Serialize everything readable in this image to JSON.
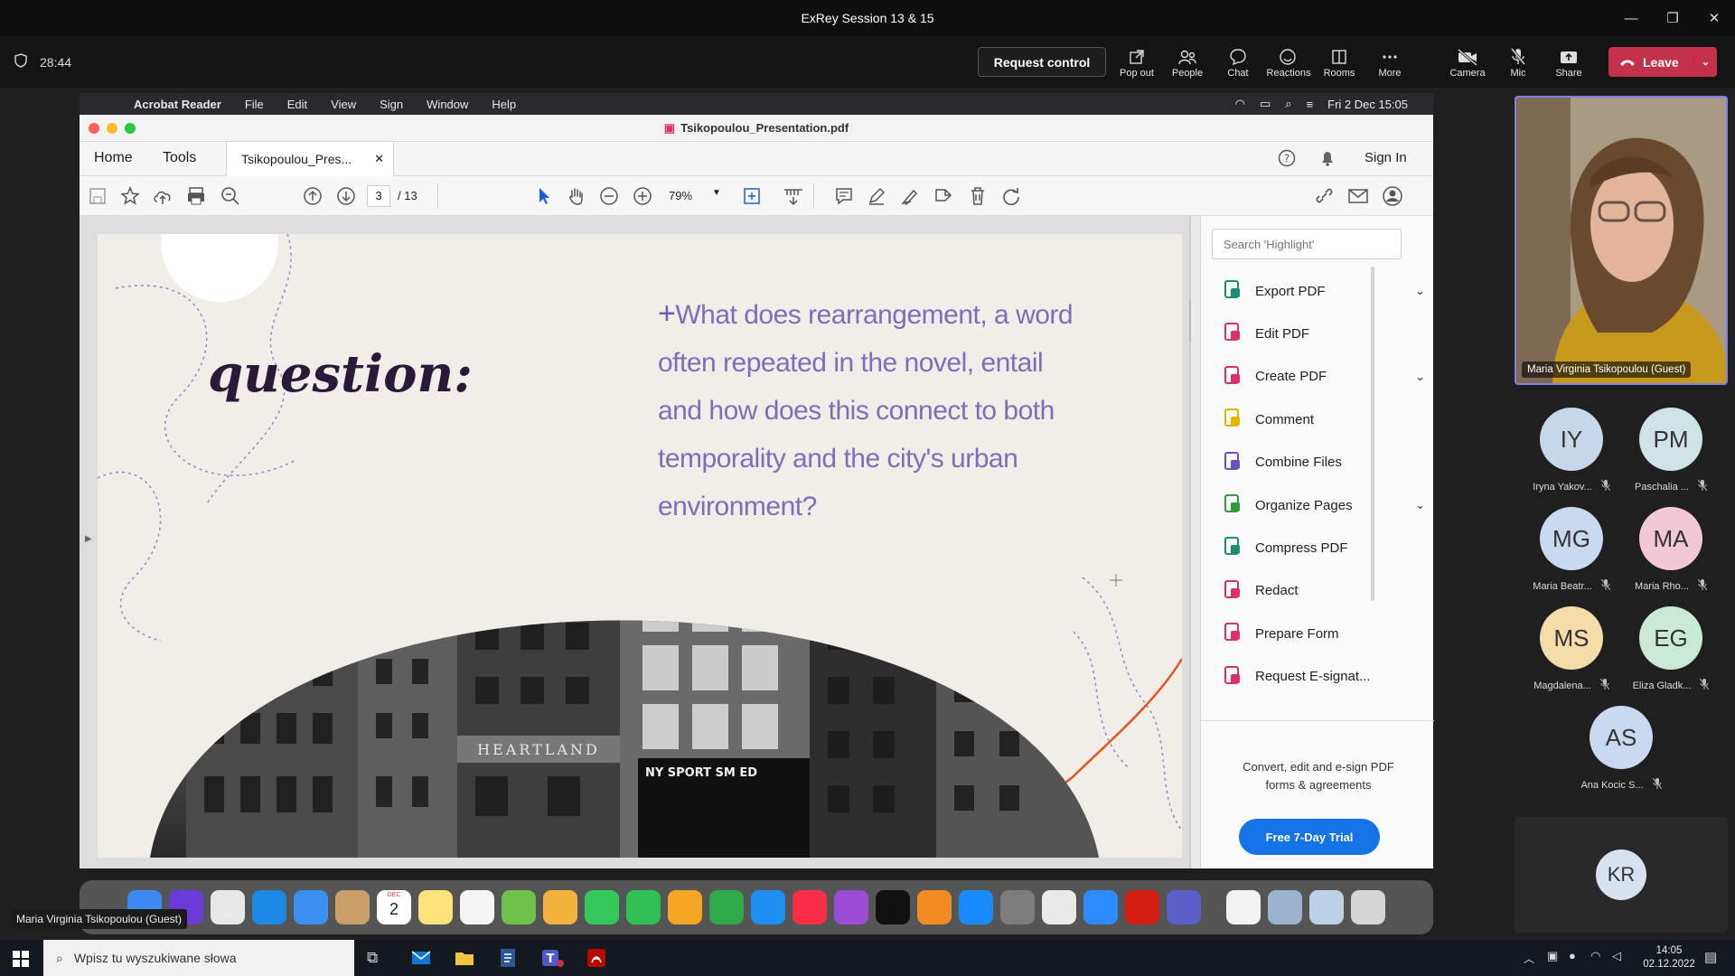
{
  "teams": {
    "title": "ExRey Session 13 & 15",
    "timer": "28:44",
    "request_control": "Request control",
    "buttons": [
      {
        "label": "Pop out",
        "icon": "popout-icon"
      },
      {
        "label": "People",
        "icon": "people-icon"
      },
      {
        "label": "Chat",
        "icon": "chat-icon"
      },
      {
        "label": "Reactions",
        "icon": "reactions-icon"
      },
      {
        "label": "Rooms",
        "icon": "rooms-icon"
      },
      {
        "label": "More",
        "icon": "more-icon"
      },
      {
        "label": "Camera",
        "icon": "camera-icon"
      },
      {
        "label": "Mic",
        "icon": "mic-icon"
      },
      {
        "label": "Share",
        "icon": "share-icon"
      }
    ],
    "leave": "Leave",
    "accent": "#c4314b"
  },
  "mac": {
    "menu": [
      "Acrobat Reader",
      "File",
      "Edit",
      "View",
      "Sign",
      "Window",
      "Help"
    ],
    "clock": "Fri 2 Dec  15:05"
  },
  "acrobat": {
    "window_title": "Tsikopoulou_Presentation.pdf",
    "home": "Home",
    "tools": "Tools",
    "tab": "Tsikopoulou_Pres...",
    "sign_in": "Sign In",
    "page_current": "3",
    "page_total": "/ 13",
    "zoom": "79%",
    "slide": {
      "heading": "question:",
      "plus": "+",
      "body": "What does rearrangement, a word often repeated in the novel, entail and how does this connect to both temporality and the city's urban environment?"
    },
    "panel": {
      "search_placeholder": "Search 'Highlight'",
      "items": [
        {
          "label": "Export PDF",
          "icon": "export-pdf-icon",
          "color": "#1b8e6f",
          "chev": true
        },
        {
          "label": "Edit PDF",
          "icon": "edit-pdf-icon",
          "color": "#d9326a",
          "chev": false
        },
        {
          "label": "Create PDF",
          "icon": "create-pdf-icon",
          "color": "#d9326a",
          "chev": true
        },
        {
          "label": "Comment",
          "icon": "comment-icon",
          "color": "#e8b300",
          "chev": false
        },
        {
          "label": "Combine Files",
          "icon": "combine-files-icon",
          "color": "#6b4fbf",
          "chev": false
        },
        {
          "label": "Organize Pages",
          "icon": "organize-pages-icon",
          "color": "#2e9d3a",
          "chev": true
        },
        {
          "label": "Compress PDF",
          "icon": "compress-pdf-icon",
          "color": "#1b8e6f",
          "chev": false
        },
        {
          "label": "Redact",
          "icon": "redact-icon",
          "color": "#d9326a",
          "chev": false
        },
        {
          "label": "Prepare Form",
          "icon": "prepare-form-icon",
          "color": "#d9326a",
          "chev": false
        },
        {
          "label": "Request E-signat...",
          "icon": "request-esign-icon",
          "color": "#d9326a",
          "chev": false
        }
      ],
      "promo": "Convert, edit and e-sign PDF forms & agreements",
      "trial": "Free 7-Day Trial"
    },
    "building_sign_1": "HEARTLAND",
    "building_sign_2": "NY SPORT SM ED"
  },
  "presenter": {
    "name": "Maria Virginia Tsikopoulou (Guest)"
  },
  "participants": [
    {
      "initials": "IY",
      "name": "Iryna Yakov...",
      "color": "#c7d7ea"
    },
    {
      "initials": "PM",
      "name": "Paschalia ...",
      "color": "#cde3e6"
    },
    {
      "initials": "MG",
      "name": "Maria Beatr...",
      "color": "#c9daf0"
    },
    {
      "initials": "MA",
      "name": "Maria Rho...",
      "color": "#f3c8d6"
    },
    {
      "initials": "MS",
      "name": "Magdalena...",
      "color": "#f4dca8"
    },
    {
      "initials": "EG",
      "name": "Eliza Gladk...",
      "color": "#c9e9d6"
    },
    {
      "initials": "AS",
      "name": "Ana Kocic S...",
      "color": "#c9daf0"
    },
    {
      "initials": "KR",
      "name": "",
      "color": "#d9e3ef"
    }
  ],
  "dock_tooltip": "Maria Virginia Tsikopoulou (Guest)",
  "dock_calendar": {
    "month": "DEC",
    "day": "2"
  },
  "windows": {
    "search_placeholder": "Wpisz tu wyszukiwane słowa",
    "time": "14:05",
    "date": "02.12.2022"
  }
}
